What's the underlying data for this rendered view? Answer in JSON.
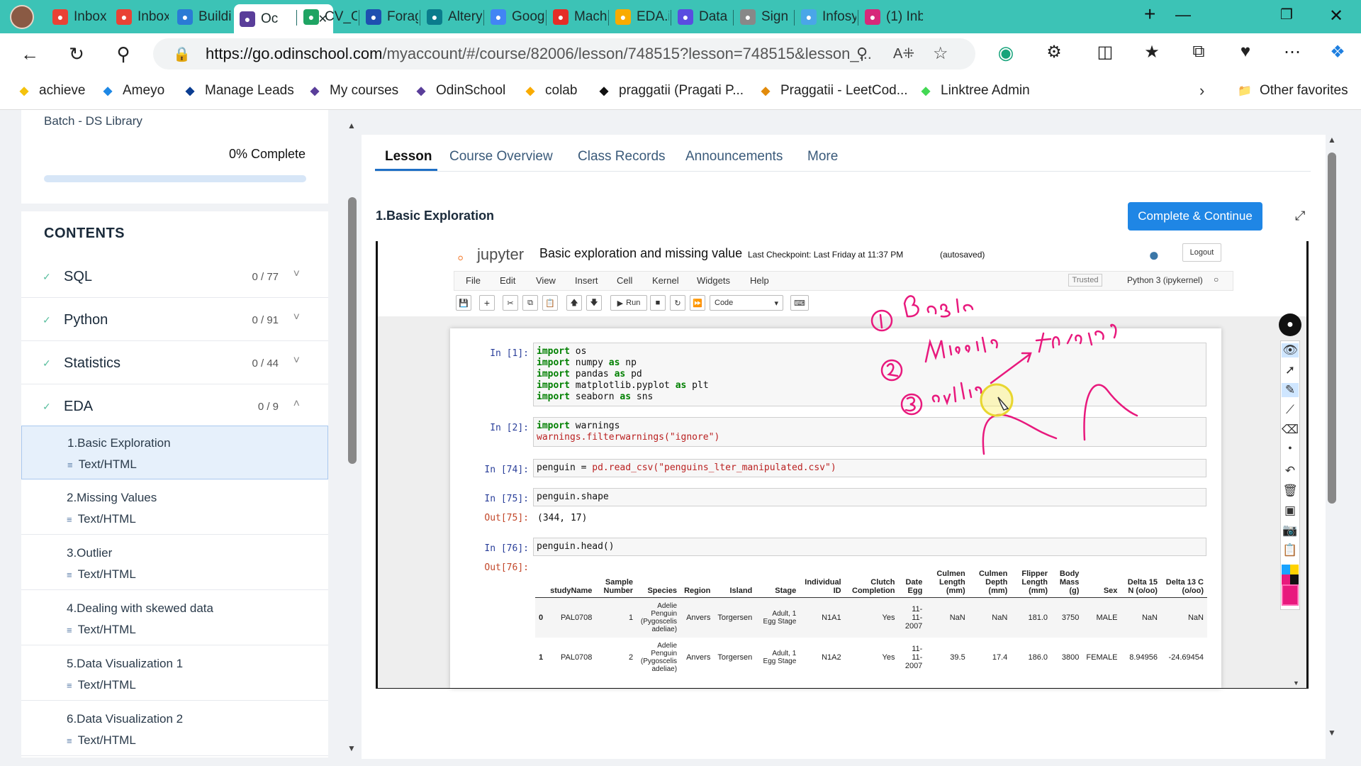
{
  "browser": {
    "tabs": [
      {
        "label": "Inbox (",
        "icon": "gmail-icon",
        "color": "#e94235"
      },
      {
        "label": "Inbox -",
        "icon": "gmail-icon",
        "color": "#e94235"
      },
      {
        "label": "Buildin",
        "icon": "play-icon",
        "color": "#2a7bd5"
      },
      {
        "label": "Oc",
        "icon": "odin-icon",
        "color": "#5a3e9a"
      },
      {
        "label": "CV_CA",
        "icon": "drive-icon",
        "color": "#1fa463"
      },
      {
        "label": "Forage",
        "icon": "forage-icon",
        "color": "#1e4fb0"
      },
      {
        "label": "Alteryx",
        "icon": "alteryx-icon",
        "color": "#0a7c8c"
      },
      {
        "label": "Google",
        "icon": "google-icon",
        "color": "#4285f4"
      },
      {
        "label": "Machir",
        "icon": "youtube-icon",
        "color": "#e52d27"
      },
      {
        "label": "EDA.ip",
        "icon": "colab-icon",
        "color": "#f9ab00"
      },
      {
        "label": "Data Sc",
        "icon": "triangle-icon",
        "color": "#5a4ce0"
      },
      {
        "label": "Sign in",
        "icon": "page-icon",
        "color": "#888888"
      },
      {
        "label": "Infosys",
        "icon": "infosys-icon",
        "color": "#4aa6e8"
      },
      {
        "label": "(1) Inb",
        "icon": "instagram-icon",
        "color": "#d6297a"
      }
    ],
    "url_domain": "https://go.odinschool.com",
    "url_path": "/myaccount/#/course/82006/lesson/748515?lesson=748515&lesson_...",
    "bookmarks": [
      {
        "label": "achieve",
        "icon": "achieve-icon"
      },
      {
        "label": "Ameyo",
        "icon": "ameyo-icon"
      },
      {
        "label": "Manage Leads",
        "icon": "leads-icon"
      },
      {
        "label": "My courses",
        "icon": "odin-icon"
      },
      {
        "label": "OdinSchool",
        "icon": "odin-icon"
      },
      {
        "label": "colab",
        "icon": "colab-icon"
      },
      {
        "label": "praggatii (Pragati P...",
        "icon": "github-icon"
      },
      {
        "label": "Praggatii - LeetCod...",
        "icon": "leetcode-icon"
      },
      {
        "label": "Linktree Admin",
        "icon": "linktree-icon"
      }
    ],
    "other_favorites": "Other favorites"
  },
  "sidebar": {
    "batch": "Batch - DS Library",
    "progress_text": "0% Complete",
    "progress": 0,
    "contents_title": "CONTENTS",
    "sections": [
      {
        "name": "SQL",
        "count": "0 / 77",
        "chevron": "chevron-down-icon"
      },
      {
        "name": "Python",
        "count": "0 / 91",
        "chevron": "chevron-down-icon"
      },
      {
        "name": "Statistics",
        "count": "0 / 44",
        "chevron": "chevron-down-icon"
      },
      {
        "name": "EDA",
        "count": "0 / 9",
        "chevron": "chevron-up-icon"
      }
    ],
    "lessons": [
      {
        "title": "1.Basic Exploration",
        "type": "Text/HTML"
      },
      {
        "title": "2.Missing Values",
        "type": "Text/HTML"
      },
      {
        "title": "3.Outlier",
        "type": "Text/HTML"
      },
      {
        "title": "4.Dealing with skewed data",
        "type": "Text/HTML"
      },
      {
        "title": "5.Data Visualization 1",
        "type": "Text/HTML"
      },
      {
        "title": "6.Data Visualization 2",
        "type": "Text/HTML"
      }
    ]
  },
  "main": {
    "tabs": [
      "Lesson",
      "Course Overview",
      "Class Records",
      "Announcements",
      "More"
    ],
    "lesson_title": "1.Basic Exploration",
    "complete_button": "Complete & Continue"
  },
  "jupyter": {
    "brand": "jupyter",
    "notebook_title": "Basic exploration and missing value",
    "checkpoint": "Last Checkpoint: Last Friday at 11:37 PM",
    "autosaved": "(autosaved)",
    "logout": "Logout",
    "menu": [
      "File",
      "Edit",
      "View",
      "Insert",
      "Cell",
      "Kernel",
      "Widgets",
      "Help"
    ],
    "trusted": "Trusted",
    "kernel": "Python 3 (ipykernel)",
    "run_label": "Run",
    "cell_type": "Code",
    "cells": [
      {
        "prompt": "In [1]:",
        "lines": [
          "import os",
          "import numpy as np",
          "import pandas as pd",
          "import matplotlib.pyplot as plt",
          "import seaborn as sns"
        ]
      },
      {
        "prompt": "In [2]:",
        "lines": [
          "import warnings",
          "warnings.filterwarnings(\"ignore\")"
        ]
      },
      {
        "prompt": "In [74]:",
        "lines": [
          "penguin = pd.read_csv(\"penguins_lter_manipulated.csv\")"
        ]
      },
      {
        "prompt": "In [75]:",
        "lines": [
          "penguin.shape"
        ],
        "out_prompt": "Out[75]:",
        "output": "(344, 17)"
      },
      {
        "prompt": "In [76]:",
        "lines": [
          "penguin.head()"
        ],
        "out_prompt": "Out[76]:"
      }
    ],
    "table": {
      "columns": [
        "",
        "studyName",
        "Sample Number",
        "Species",
        "Region",
        "Island",
        "Stage",
        "Individual ID",
        "Clutch Completion",
        "Date Egg",
        "Culmen Length (mm)",
        "Culmen Depth (mm)",
        "Flipper Length (mm)",
        "Body Mass (g)",
        "Sex",
        "Delta 15 N (o/oo)",
        "Delta 13 C (o/oo)"
      ],
      "rows": [
        [
          "0",
          "PAL0708",
          "1",
          "Adelie Penguin (Pygoscelis adeliae)",
          "Anvers",
          "Torgersen",
          "Adult, 1 Egg Stage",
          "N1A1",
          "Yes",
          "11-11-2007",
          "NaN",
          "NaN",
          "181.0",
          "3750",
          "MALE",
          "NaN",
          "NaN"
        ],
        [
          "1",
          "PAL0708",
          "2",
          "Adelie Penguin (Pygoscelis adeliae)",
          "Anvers",
          "Torgersen",
          "Adult, 1 Egg Stage",
          "N1A2",
          "Yes",
          "11-11-2007",
          "39.5",
          "17.4",
          "186.0",
          "3800",
          "FEMALE",
          "8.94956",
          "-24.69454"
        ]
      ]
    }
  },
  "annotations": {
    "ink_color": "#e8197d",
    "notes": [
      "1 Basic",
      "2 Missing",
      "3 outliers",
      "transform"
    ]
  }
}
